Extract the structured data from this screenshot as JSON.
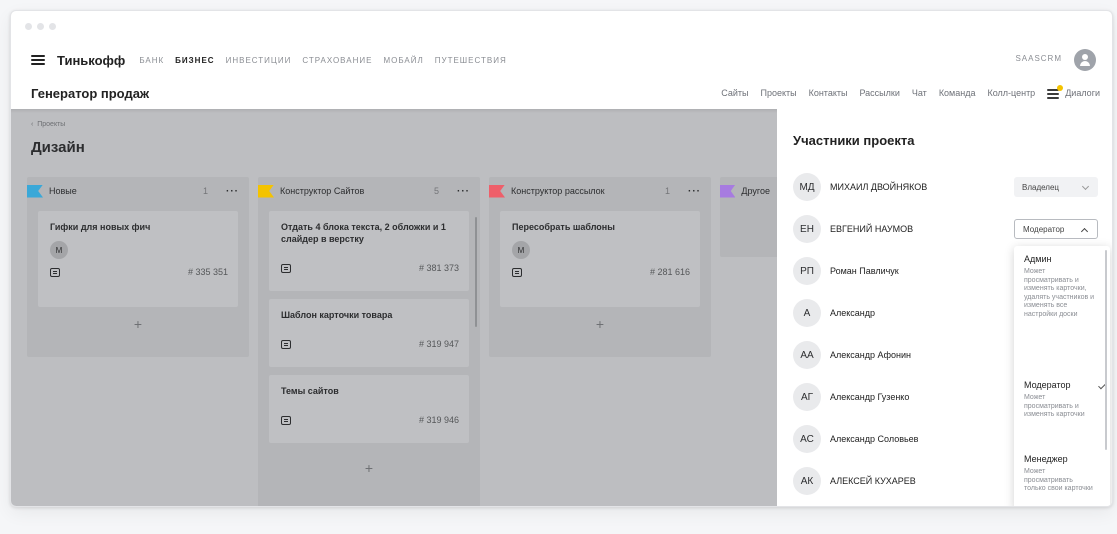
{
  "topbar": {
    "brand": "Тинькофф",
    "nav": [
      "БАНК",
      "БИЗНЕС",
      "ИНВЕСТИЦИИ",
      "СТРАХОВАНИЕ",
      "МОБАЙЛ",
      "ПУТЕШЕСТВИЯ"
    ],
    "active_nav": "БИЗНЕС",
    "user": "SAASCRM"
  },
  "subheader": {
    "title": "Генератор продаж",
    "nav": [
      "Сайты",
      "Проекты",
      "Контакты",
      "Рассылки",
      "Чат",
      "Команда",
      "Колл-центр"
    ],
    "dialogs": "Диалоги"
  },
  "board": {
    "breadcrumb": "Проекты",
    "title": "Дизайн",
    "columns": [
      {
        "title": "Новые",
        "count": "1",
        "color": "#3aa8d8",
        "cards": [
          {
            "title": "Гифки для новых фич",
            "avatar": "М",
            "id": "# 335 351"
          }
        ],
        "add": "+"
      },
      {
        "title": "Конструктор Сайтов",
        "count": "5",
        "color": "#f4c300",
        "cards": [
          {
            "title": "Отдать 4 блока текста, 2 обложки и 1 слайдер в верстку",
            "id": "# 381 373"
          },
          {
            "title": "Шаблон карточки товара",
            "id": "# 319 947"
          },
          {
            "title": "Темы сайтов",
            "id": "# 319 946"
          }
        ],
        "add": "+"
      },
      {
        "title": "Конструктор рассылок",
        "count": "1",
        "color": "#ee5f6a",
        "cards": [
          {
            "title": "Пересобрать шаблоны",
            "avatar": "М",
            "id": "# 281 616"
          }
        ],
        "add": "+"
      },
      {
        "title": "Другое",
        "color": "#a77be0"
      }
    ]
  },
  "panel": {
    "title": "Участники проекта",
    "members": [
      {
        "initials": "МД",
        "name": "МИХАИЛ ДВОЙНЯКОВ",
        "role": "Владелец"
      },
      {
        "initials": "ЕН",
        "name": "ЕВГЕНИЙ НАУМОВ",
        "role": "Модератор"
      },
      {
        "initials": "РП",
        "name": "Роман Павличук"
      },
      {
        "initials": "А",
        "name": "Александр"
      },
      {
        "initials": "АА",
        "name": "Александр Афонин"
      },
      {
        "initials": "АГ",
        "name": "Александр Гузенко"
      },
      {
        "initials": "АС",
        "name": "Александр Соловьев"
      },
      {
        "initials": "АК",
        "name": "АЛЕКСЕЙ КУХАРЕВ"
      }
    ],
    "role_options": [
      {
        "title": "Админ",
        "desc": "Может просматривать и изменять карточки, удалять участников и изменять все настройки доски"
      },
      {
        "title": "Модератор",
        "desc": "Может просматривать и изменять карточки",
        "selected": true
      },
      {
        "title": "Менеджер",
        "desc": "Может просматривать только свои карточки"
      }
    ]
  }
}
